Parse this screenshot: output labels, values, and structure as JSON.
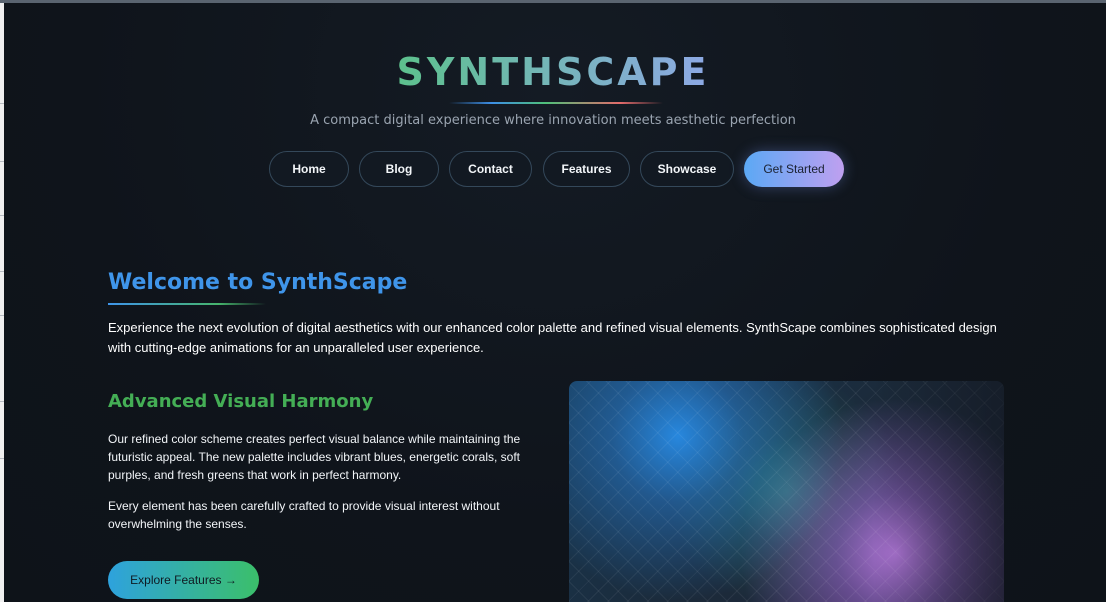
{
  "brand": {
    "title": "SYNTHSCAPE",
    "tagline": "A compact digital experience where innovation meets aesthetic perfection"
  },
  "nav": {
    "items": [
      {
        "label": "Home"
      },
      {
        "label": "Blog"
      },
      {
        "label": "Contact"
      },
      {
        "label": "Features"
      },
      {
        "label": "Showcase"
      }
    ],
    "cta": "Get Started"
  },
  "welcome": {
    "title": "Welcome to SynthScape",
    "text": "Experience the next evolution of digital aesthetics with our enhanced color palette and refined visual elements. SynthScape combines sophisticated design with cutting-edge animations for an unparalleled user experience."
  },
  "harmony": {
    "title": "Advanced Visual Harmony",
    "paragraph_1": "Our refined color scheme creates perfect visual balance while maintaining the futuristic appeal. The new palette includes vibrant blues, energetic corals, soft purples, and fresh greens that work in perfect harmony.",
    "paragraph_2": "Every element has been carefully crafted to provide visual interest without overwhelming the senses.",
    "button": "Explore Features →"
  },
  "colors": {
    "background": "#0f141b",
    "accent_blue": "#3f95ea",
    "accent_green": "#44ae55",
    "accent_purple": "#bfa0f0"
  }
}
